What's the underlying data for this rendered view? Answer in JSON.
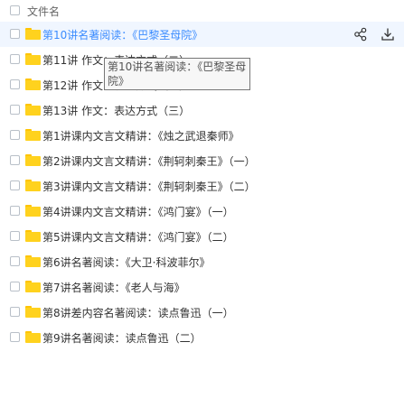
{
  "header": {
    "title": "文件名"
  },
  "files": [
    {
      "label": "第10讲名著阅读：《巴黎圣母院》"
    },
    {
      "label": "第11讲 作文：表达方式（二）"
    },
    {
      "label": "第12讲 作文：表达方式（一）"
    },
    {
      "label": "第13讲 作文：表达方式（三）"
    },
    {
      "label": "第1讲课内文言文精讲：《烛之武退秦师》"
    },
    {
      "label": "第2讲课内文言文精讲：《荆轲刺秦王》（一）"
    },
    {
      "label": "第3讲课内文言文精讲：《荆轲刺秦王》（二）"
    },
    {
      "label": "第4讲课内文言文精讲：《鸿门宴》（一）"
    },
    {
      "label": "第5讲课内文言文精讲：《鸿门宴》（二）"
    },
    {
      "label": "第6讲名著阅读：《大卫·科波菲尔》"
    },
    {
      "label": "第7讲名著阅读：《老人与海》"
    },
    {
      "label": "第8讲差内容名著阅读：读点鲁迅（一）"
    },
    {
      "label": "第9讲名著阅读：读点鲁迅（二）"
    }
  ],
  "tooltip": {
    "text": "第10讲名著阅读：《巴黎圣母院》"
  },
  "icons": {
    "share": "share-icon",
    "download": "download-icon",
    "folder": "folder-icon"
  },
  "colors": {
    "accent": "#3b8cff",
    "row_hover": "#f0f6ff",
    "folder": "#ffd21e"
  }
}
